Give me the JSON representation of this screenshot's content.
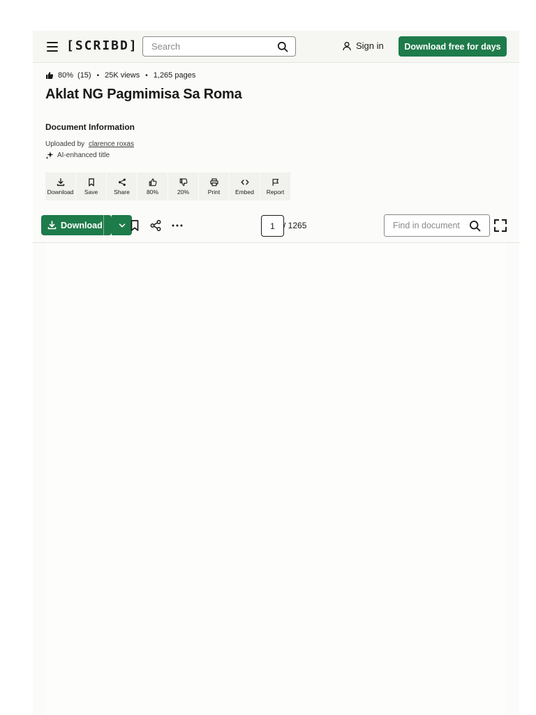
{
  "header": {
    "logo": "[SCRIBD]",
    "search_placeholder": "Search",
    "sign_in": "Sign in",
    "download_free": "Download free for days"
  },
  "document": {
    "rating": "80%",
    "rating_count": "(15)",
    "views": "25K views",
    "pages_count": "1,265 pages",
    "separator": "•",
    "title": "Aklat NG Pagmimisa Sa Roma",
    "info_heading": "Document Information",
    "uploaded_by_label": "Uploaded by",
    "uploader": "clarence roxas",
    "ai_label": "AI-enhanced title"
  },
  "actions": [
    {
      "label": "Download",
      "icon": "download-icon"
    },
    {
      "label": "Save",
      "icon": "bookmark-icon"
    },
    {
      "label": "Share",
      "icon": "share-icon"
    },
    {
      "label": "80%",
      "icon": "thumbs-up-icon"
    },
    {
      "label": "20%",
      "icon": "thumbs-down-icon"
    },
    {
      "label": "Print",
      "icon": "print-icon"
    },
    {
      "label": "Embed",
      "icon": "embed-icon"
    },
    {
      "label": "Report",
      "icon": "flag-icon"
    }
  ],
  "toolbar": {
    "download_label": "Download",
    "current_page": "1",
    "total_pages": "/ 1265",
    "find_placeholder": "Find in document"
  },
  "colors": {
    "brand_green": "#1e7b4a",
    "background": "#fbfbf9"
  }
}
